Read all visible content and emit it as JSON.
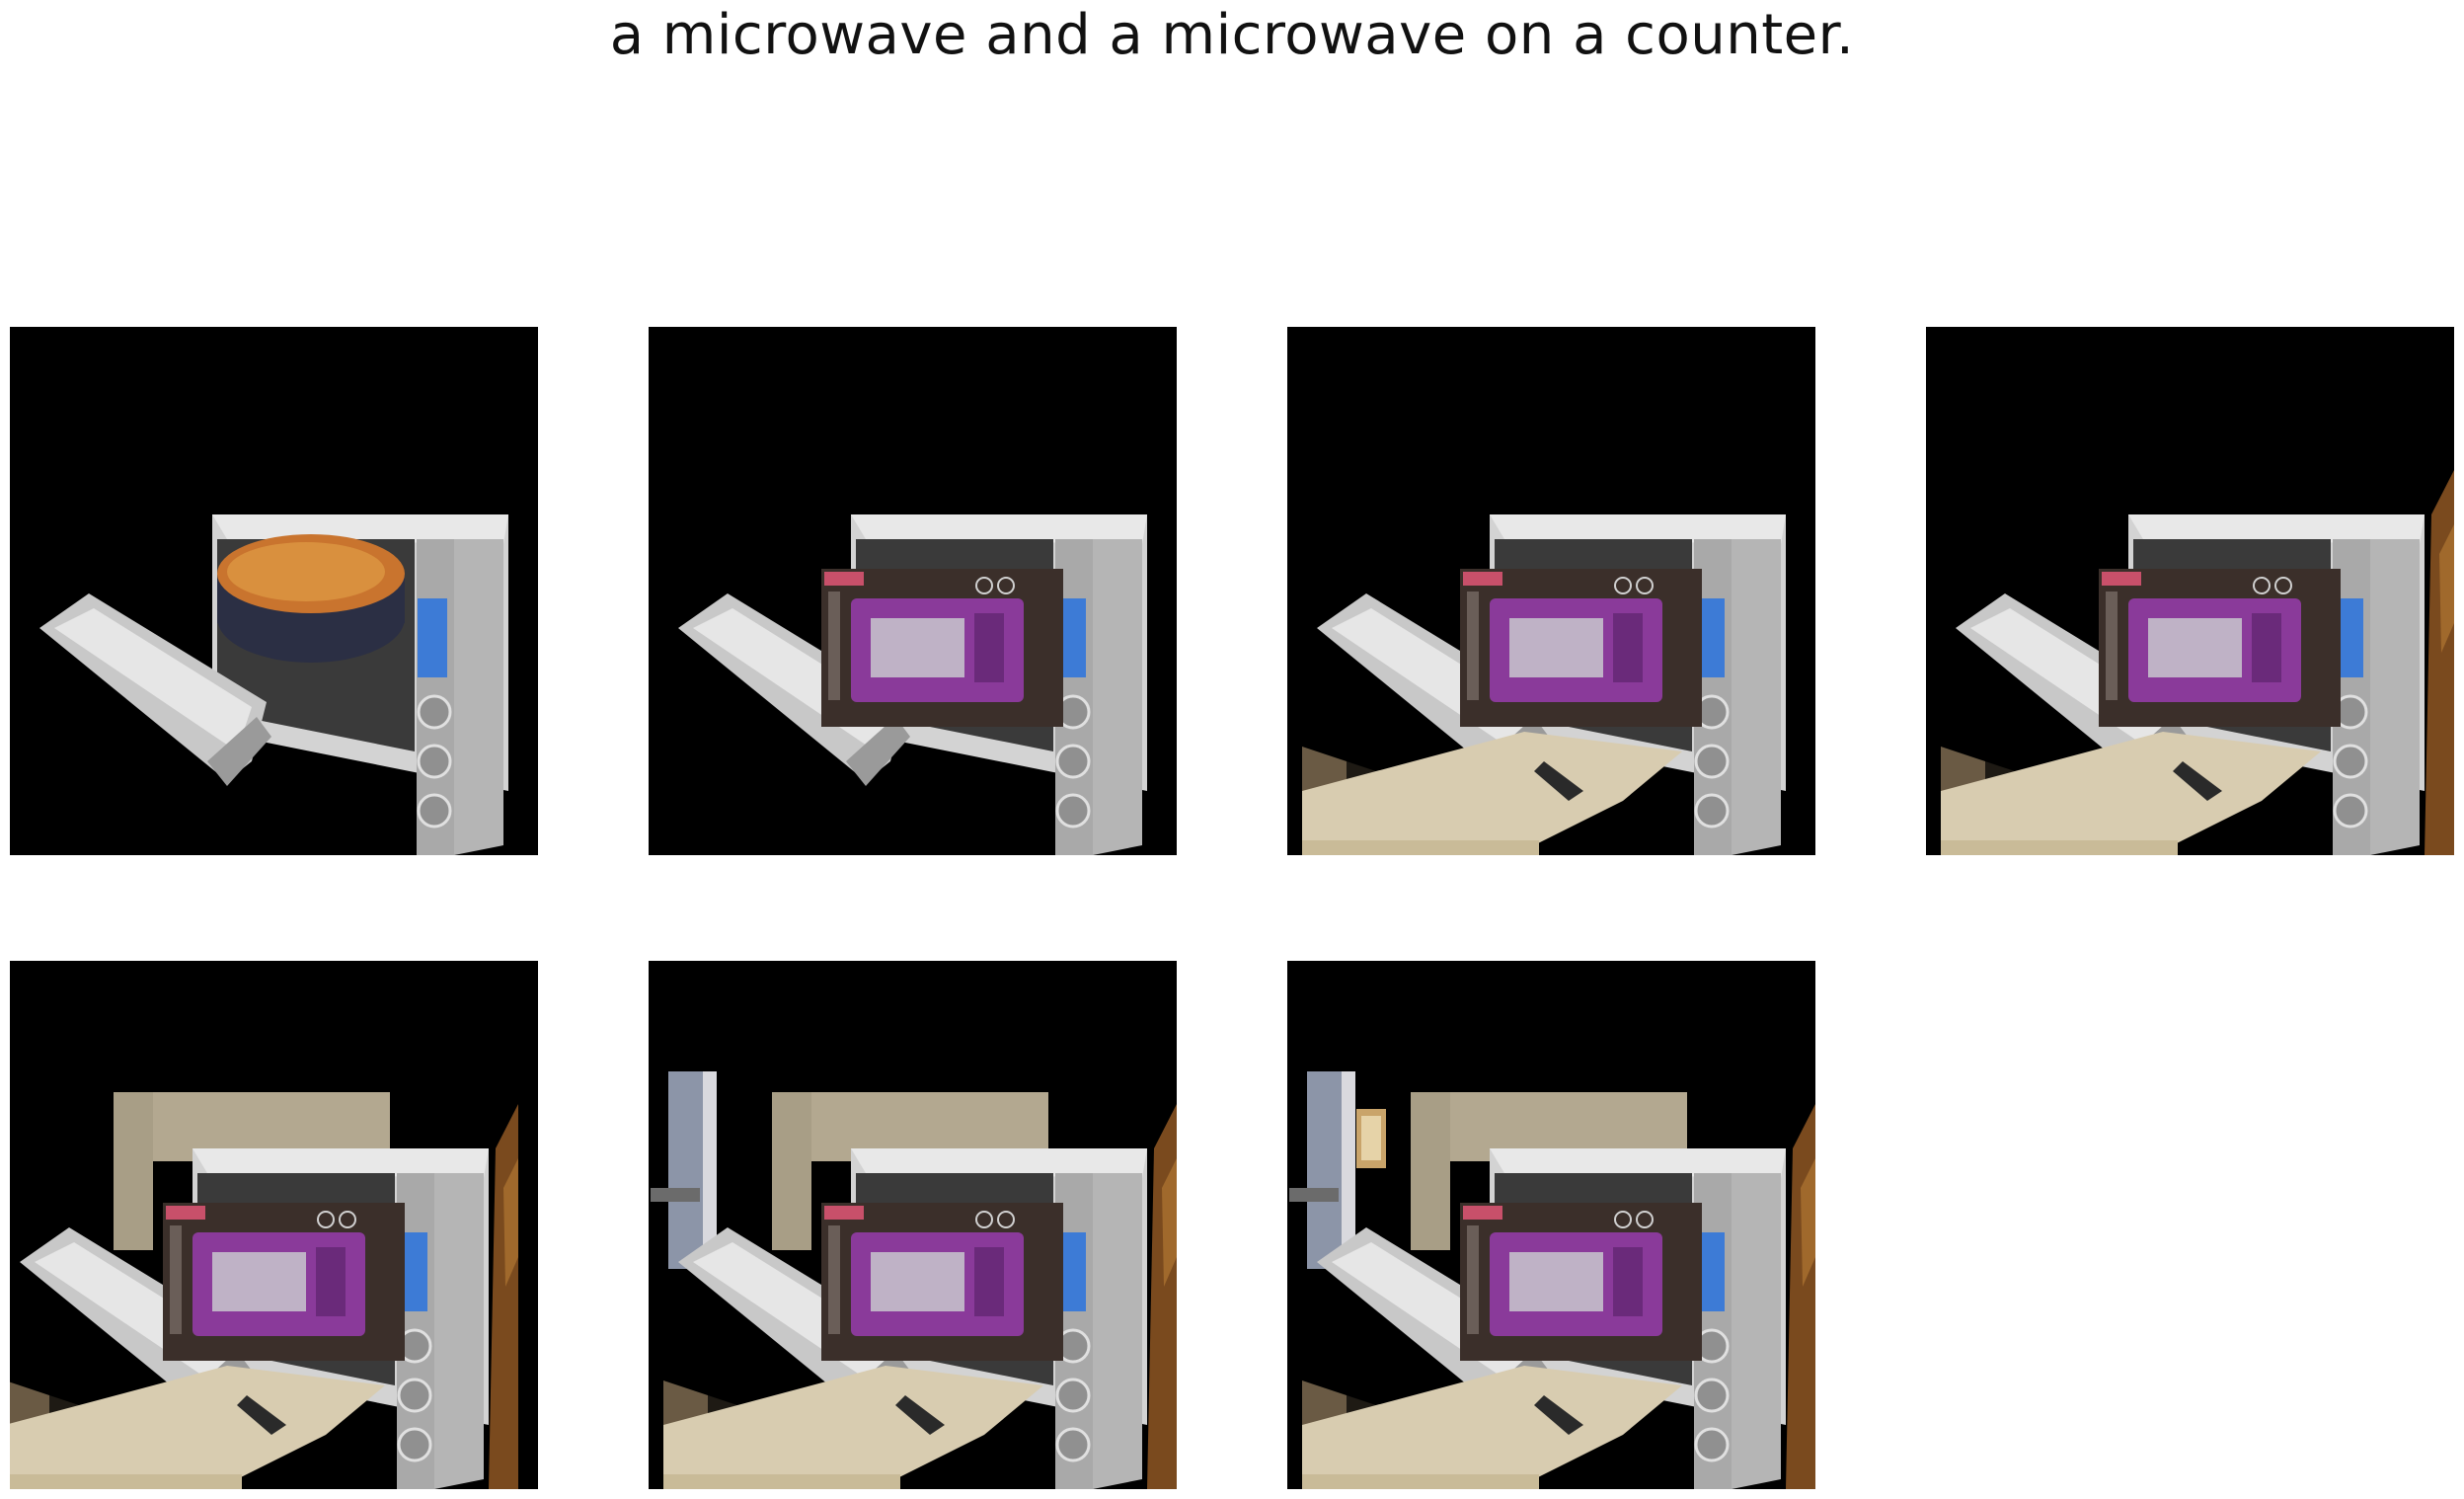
{
  "caption": "a microwave and a microwave on a counter.",
  "panels": [
    {
      "id": 1,
      "layers": [
        "oven",
        "dish"
      ]
    },
    {
      "id": 2,
      "layers": [
        "oven",
        "box"
      ]
    },
    {
      "id": 3,
      "layers": [
        "oven",
        "box",
        "counter"
      ]
    },
    {
      "id": 4,
      "layers": [
        "oven",
        "box",
        "counter",
        "right-wood"
      ]
    },
    {
      "id": 5,
      "layers": [
        "wall",
        "oven",
        "box",
        "counter",
        "right-wood"
      ]
    },
    {
      "id": 6,
      "layers": [
        "wall",
        "oven",
        "box",
        "counter",
        "right-wood",
        "left-door"
      ]
    },
    {
      "id": 7,
      "layers": [
        "wall",
        "oven",
        "box",
        "counter",
        "right-wood",
        "left-door",
        "cabinet"
      ]
    }
  ],
  "colors": {
    "background": "#000000",
    "oven_body": "#c9c9c9",
    "box": "#3b2f2a",
    "microwave_purple": "#8a3a9a",
    "counter": "#d8ccb0",
    "wall": "#b3a890"
  }
}
